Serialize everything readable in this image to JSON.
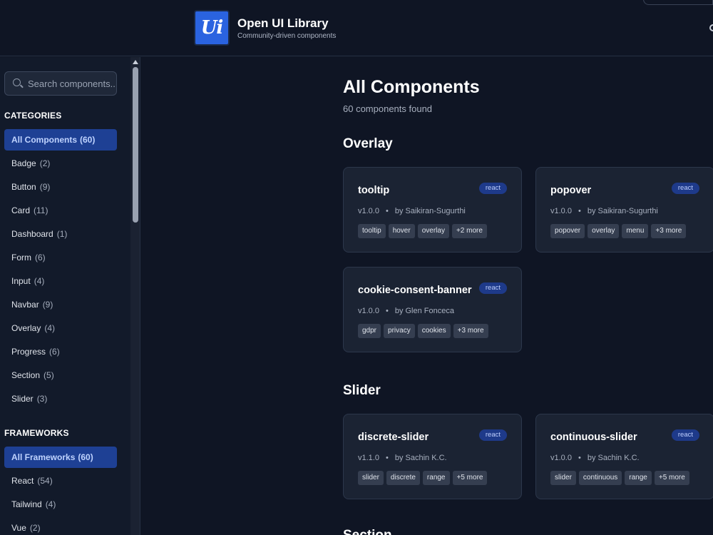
{
  "brand": {
    "logo_text": "Ui",
    "title": "Open UI Library",
    "subtitle": "Community-driven components"
  },
  "search": {
    "placeholder": "Search components..."
  },
  "categories": {
    "title": "CATEGORIES",
    "items": [
      {
        "label": "All Components",
        "count": "(60)",
        "active": true
      },
      {
        "label": "Badge",
        "count": "(2)"
      },
      {
        "label": "Button",
        "count": "(9)"
      },
      {
        "label": "Card",
        "count": "(11)"
      },
      {
        "label": "Dashboard",
        "count": "(1)"
      },
      {
        "label": "Form",
        "count": "(6)"
      },
      {
        "label": "Input",
        "count": "(4)"
      },
      {
        "label": "Navbar",
        "count": "(9)"
      },
      {
        "label": "Overlay",
        "count": "(4)"
      },
      {
        "label": "Progress",
        "count": "(6)"
      },
      {
        "label": "Section",
        "count": "(5)"
      },
      {
        "label": "Slider",
        "count": "(3)"
      }
    ]
  },
  "frameworks": {
    "title": "FRAMEWORKS",
    "items": [
      {
        "label": "All Frameworks",
        "count": "(60)",
        "active": true
      },
      {
        "label": "React",
        "count": "(54)"
      },
      {
        "label": "Tailwind",
        "count": "(4)"
      },
      {
        "label": "Vue",
        "count": "(2)"
      }
    ]
  },
  "main": {
    "title": "All Components",
    "subtitle": "60 components found",
    "groups": [
      {
        "title": "Overlay",
        "cards": [
          {
            "name": "tooltip",
            "framework": "react",
            "version": "v1.0.0",
            "author": "by Saikiran-Sugurthi",
            "tags": [
              "tooltip",
              "hover",
              "overlay",
              "+2 more"
            ]
          },
          {
            "name": "popover",
            "framework": "react",
            "version": "v1.0.0",
            "author": "by Saikiran-Sugurthi",
            "tags": [
              "popover",
              "overlay",
              "menu",
              "+3 more"
            ]
          },
          {
            "name": "cookie-consent-banner",
            "framework": "react",
            "version": "v1.0.0",
            "author": "by Glen Fonceca",
            "tags": [
              "gdpr",
              "privacy",
              "cookies",
              "+3 more"
            ]
          }
        ]
      },
      {
        "title": "Slider",
        "cards": [
          {
            "name": "discrete-slider",
            "framework": "react",
            "version": "v1.1.0",
            "author": "by Sachin K.C.",
            "tags": [
              "slider",
              "discrete",
              "range",
              "+5 more"
            ]
          },
          {
            "name": "continuous-slider",
            "framework": "react",
            "version": "v1.0.0",
            "author": "by Sachin K.C.",
            "tags": [
              "slider",
              "continuous",
              "range",
              "+5 more"
            ]
          }
        ]
      },
      {
        "title": "Section",
        "cards": []
      }
    ],
    "separator": "•"
  }
}
